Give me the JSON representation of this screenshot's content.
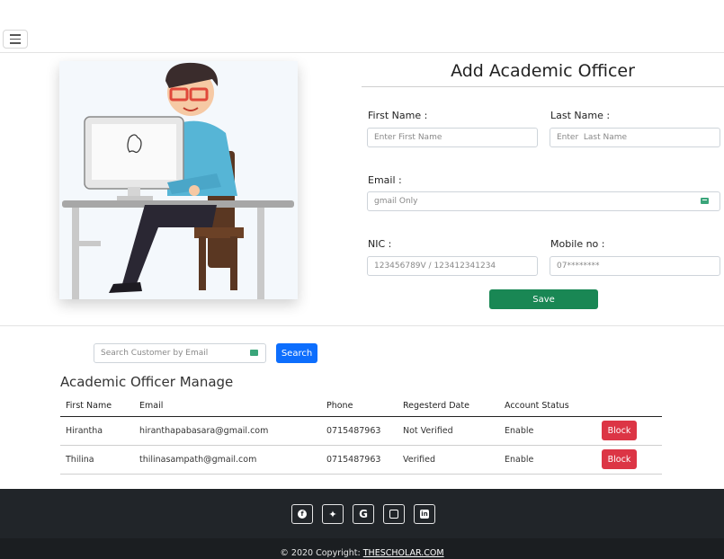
{
  "form": {
    "title": "Add Academic Officer",
    "first_name_label": "First Name :",
    "first_name_placeholder": "Enter First Name",
    "last_name_label": "Last Name :",
    "last_name_placeholder": "Enter  Last Name",
    "email_label": "Email :",
    "email_placeholder": "gmail Only",
    "nic_label": "NIC :",
    "nic_placeholder": "123456789V / 123412341234",
    "mobile_label": "Mobile no :",
    "mobile_placeholder": "07********",
    "save_label": "Save"
  },
  "search": {
    "placeholder": "Search Customer by Email",
    "button_label": "Search"
  },
  "manage": {
    "title": "Academic Officer Manage",
    "columns": [
      "First Name",
      "Email",
      "Phone",
      "Regesterd Date",
      "Account Status"
    ],
    "rows": [
      {
        "first_name": "Hirantha",
        "email": "hiranthapabasara@gmail.com",
        "phone": "0715487963",
        "registered": "Not Verified",
        "status": "Enable",
        "action": "Block"
      },
      {
        "first_name": "Thilina",
        "email": "thilinasampath@gmail.com",
        "phone": "0715487963",
        "registered": "Verified",
        "status": "Enable",
        "action": "Block"
      }
    ]
  },
  "footer": {
    "social_icons": [
      "facebook-icon",
      "twitter-icon",
      "google-icon",
      "instagram-icon",
      "linkedin-icon"
    ],
    "copyright_text": "© 2020 Copyright: ",
    "copyright_link": "THESCHOLAR.COM"
  },
  "colors": {
    "save": "#198754",
    "search": "#0d6efd",
    "block": "#dc3545",
    "footer": "#212529"
  }
}
